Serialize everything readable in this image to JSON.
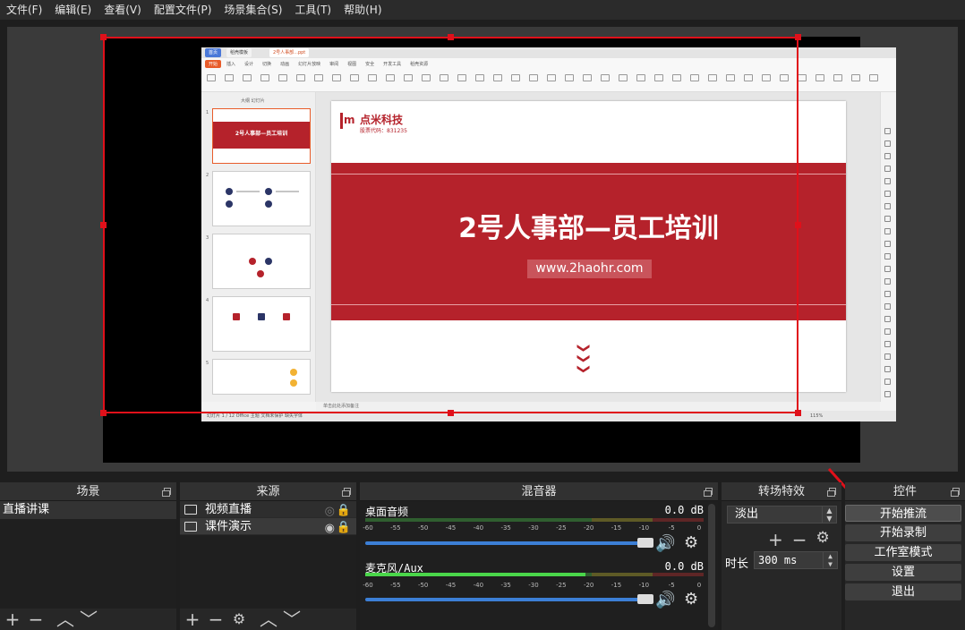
{
  "menu": [
    "文件(F)",
    "编辑(E)",
    "查看(V)",
    "配置文件(P)",
    "场景集合(S)",
    "工具(T)",
    "帮助(H)"
  ],
  "capture": {
    "tabs": [
      "首页",
      "稻壳模板",
      "2号人事部...ppt"
    ],
    "ribbon_tabs": [
      "开始",
      "插入",
      "设计",
      "切换",
      "动画",
      "幻灯片放映",
      "审阅",
      "视图",
      "安全",
      "开发工具",
      "稻壳资源"
    ],
    "left_panel_head": "大纲  幻灯片",
    "slide_logo_text": "点米科技",
    "slide_logo_sub": "股票代码：831235",
    "slide_logo_mark": "m",
    "slide_title": "2号人事部—员工培训",
    "slide_url": "www.2haohr.com",
    "slide_chevrons": "❯❯❯",
    "thumb_title": "2号人事部—员工培训",
    "thumb_numbers": [
      "1",
      "2",
      "3",
      "4",
      "5"
    ],
    "notes": "单击此处添加备注",
    "status_left": "幻灯片 1 / 12    Office 主题    文档未保护    缺失字体",
    "status_right": "115%"
  },
  "docks": {
    "scenes": {
      "title": "场景",
      "items": [
        "直播讲课"
      ]
    },
    "sources": {
      "title": "来源",
      "items": [
        {
          "label": "视频直播",
          "visible": false
        },
        {
          "label": "课件演示",
          "visible": true
        }
      ]
    },
    "mixer": {
      "title": "混音器",
      "channels": [
        {
          "name": "桌面音频",
          "db": "0.0 dB",
          "level": 0
        },
        {
          "name": "麦克风/Aux",
          "db": "0.0 dB",
          "level": 0.65
        }
      ],
      "scale": [
        "-60",
        "-55",
        "-50",
        "-45",
        "-40",
        "-35",
        "-30",
        "-25",
        "-20",
        "-15",
        "-10",
        "-5",
        "0"
      ]
    },
    "transitions": {
      "title": "转场特效",
      "selected": "淡出",
      "duration_label": "时长",
      "duration_value": "300 ms"
    },
    "controls": {
      "title": "控件",
      "buttons": [
        "开始推流",
        "开始录制",
        "工作室模式",
        "设置",
        "退出"
      ]
    }
  },
  "toolbar_glyphs": {
    "add": "+",
    "remove": "−",
    "up": "︿",
    "down": "﹀",
    "gear": "⚙",
    "volume": "🔊"
  },
  "colors": {
    "selection": "#e0101a",
    "brand_red": "#b5222b",
    "slider_blue": "#3c7fd6"
  }
}
